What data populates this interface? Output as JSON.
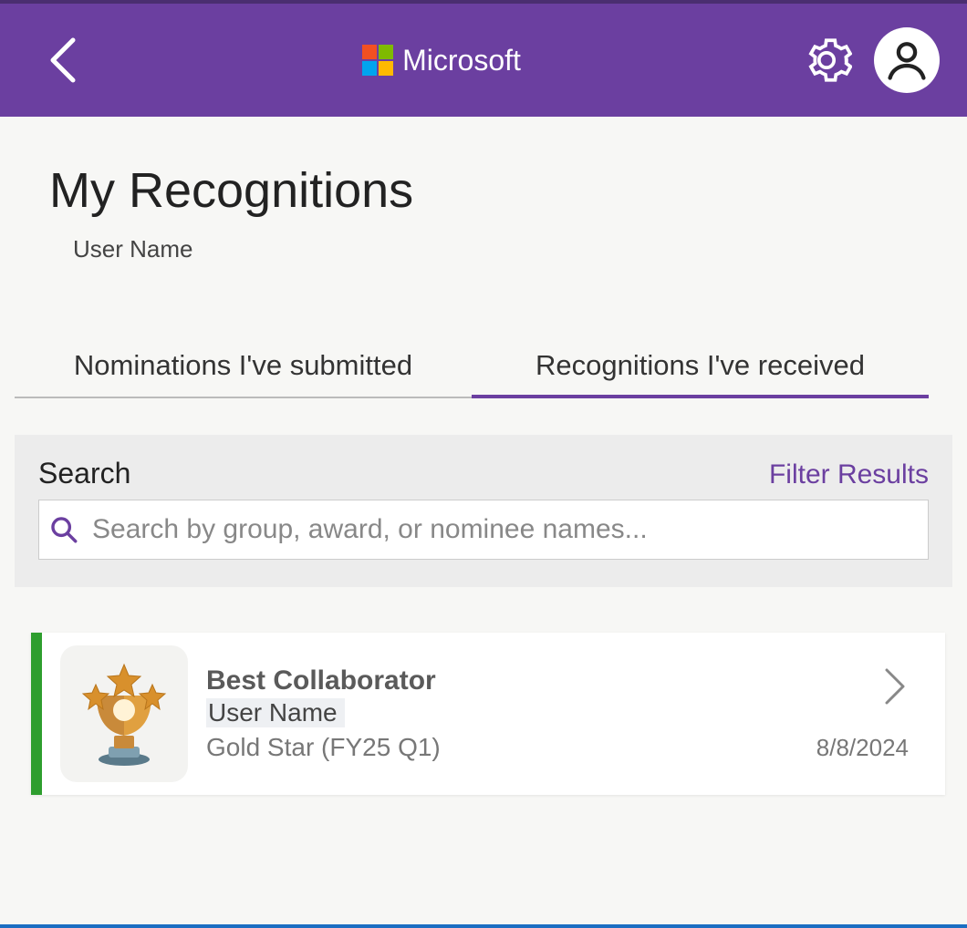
{
  "header": {
    "brand": "Microsoft"
  },
  "page": {
    "title": "My Recognitions",
    "subtitle": "User Name"
  },
  "tabs": [
    {
      "label": "Nominations I've submitted",
      "active": false
    },
    {
      "label": "Recognitions I've received",
      "active": true
    }
  ],
  "search": {
    "label": "Search",
    "filter_label": "Filter Results",
    "placeholder": "Search by group, award, or nominee names..."
  },
  "results": [
    {
      "title": "Best Collaborator",
      "user": "User Name",
      "period": "Gold Star (FY25 Q1)",
      "date": "8/8/2024",
      "accent_color": "#2e9e2e"
    }
  ]
}
